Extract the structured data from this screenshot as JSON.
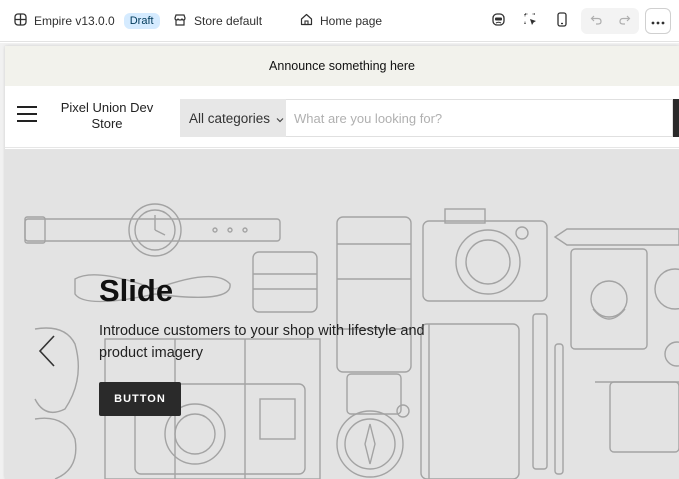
{
  "editor": {
    "theme_name": "Empire v13.0.0",
    "theme_status": "Draft",
    "store_context": "Store default",
    "page_selector": "Home page",
    "icons": {
      "theme": "theme-icon",
      "store": "store-icon",
      "home": "home-icon",
      "inspector": "inspector-icon",
      "select": "select-element-icon",
      "mobile": "mobile-preview-icon",
      "undo": "undo-icon",
      "redo": "redo-icon",
      "more": "more-icon"
    }
  },
  "storefront": {
    "announcement": "Announce something here",
    "store_name": "Pixel Union Dev Store",
    "search": {
      "category": "All categories",
      "placeholder": "What are you looking for?"
    },
    "slide": {
      "heading": "Slide",
      "text": "Introduce customers to your shop with lifestyle and product imagery",
      "button": "BUTTON"
    }
  },
  "colors": {
    "badge_bg": "#d5ebff",
    "announcement_bg": "#f2f2ec",
    "hero_bg": "#e3e3e3",
    "button_bg": "#2a2a2a"
  }
}
